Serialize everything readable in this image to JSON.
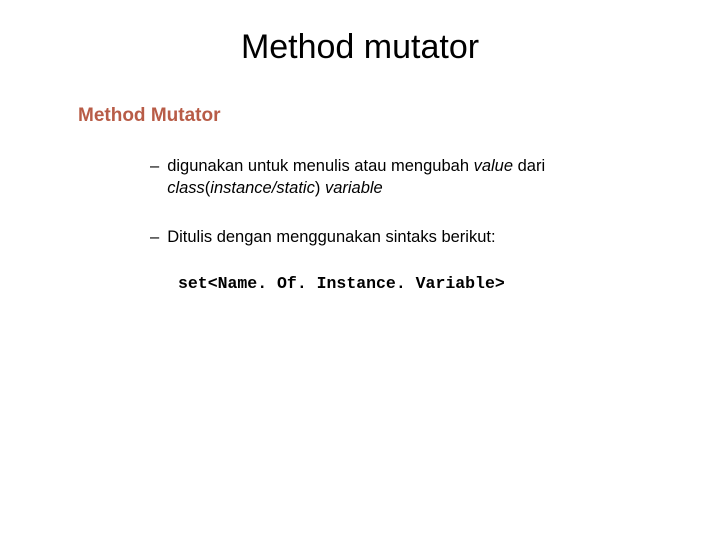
{
  "title": "Method mutator",
  "subtitle": "Method Mutator",
  "bullet1": {
    "dash": "–",
    "pre": "digunakan untuk menulis atau mengubah ",
    "italic1": "value ",
    "mid": "dari ",
    "italic2": "class",
    "paren_open": "(",
    "italic3": "instance/static",
    "paren_close": ") ",
    "italic4": "variable"
  },
  "bullet2": {
    "dash": "–",
    "text": "Ditulis dengan menggunakan sintaks berikut:"
  },
  "code": "set<Name. Of. Instance. Variable>"
}
